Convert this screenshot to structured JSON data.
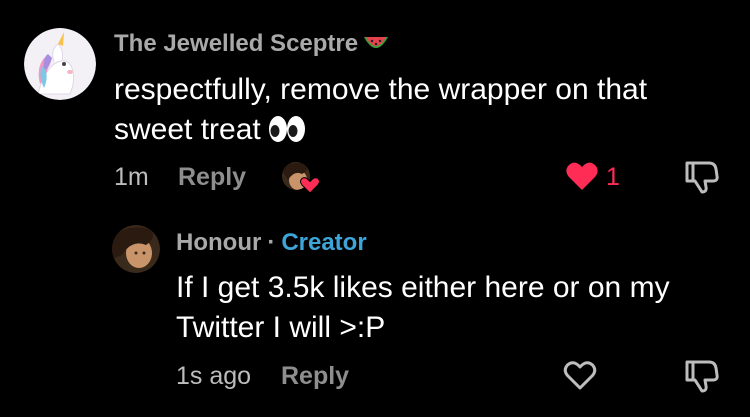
{
  "comment": {
    "username": "The Jewelled Sceptre",
    "username_emoji": "watermelon-emoji",
    "text": "respectfully, remove the wrapper on that sweet treat",
    "text_emoji": "eyes-emoji",
    "timestamp": "1m",
    "reply_label": "Reply",
    "like_count": "1",
    "liked": true,
    "like_color": "#ff2d55"
  },
  "reply": {
    "author": "Honour",
    "separator": "·",
    "badge": "Creator",
    "badge_color": "#3ea5d9",
    "text": "If I get 3.5k likes either here or on my Twitter I will >:P",
    "timestamp": "1s ago",
    "reply_label": "Reply",
    "liked": false
  },
  "icons": {
    "main_avatar": "unicorn-avatar",
    "reply_avatar": "user-photo-avatar",
    "creator_liked": "creator-liked-avatar-icon",
    "like": "heart-icon",
    "dislike": "thumbs-down-icon"
  },
  "colors": {
    "background": "#000000",
    "username": "#a9a9a9",
    "text": "#ffffff",
    "meta": "#bdbdbd",
    "reply_action": "#8e8e8e"
  }
}
